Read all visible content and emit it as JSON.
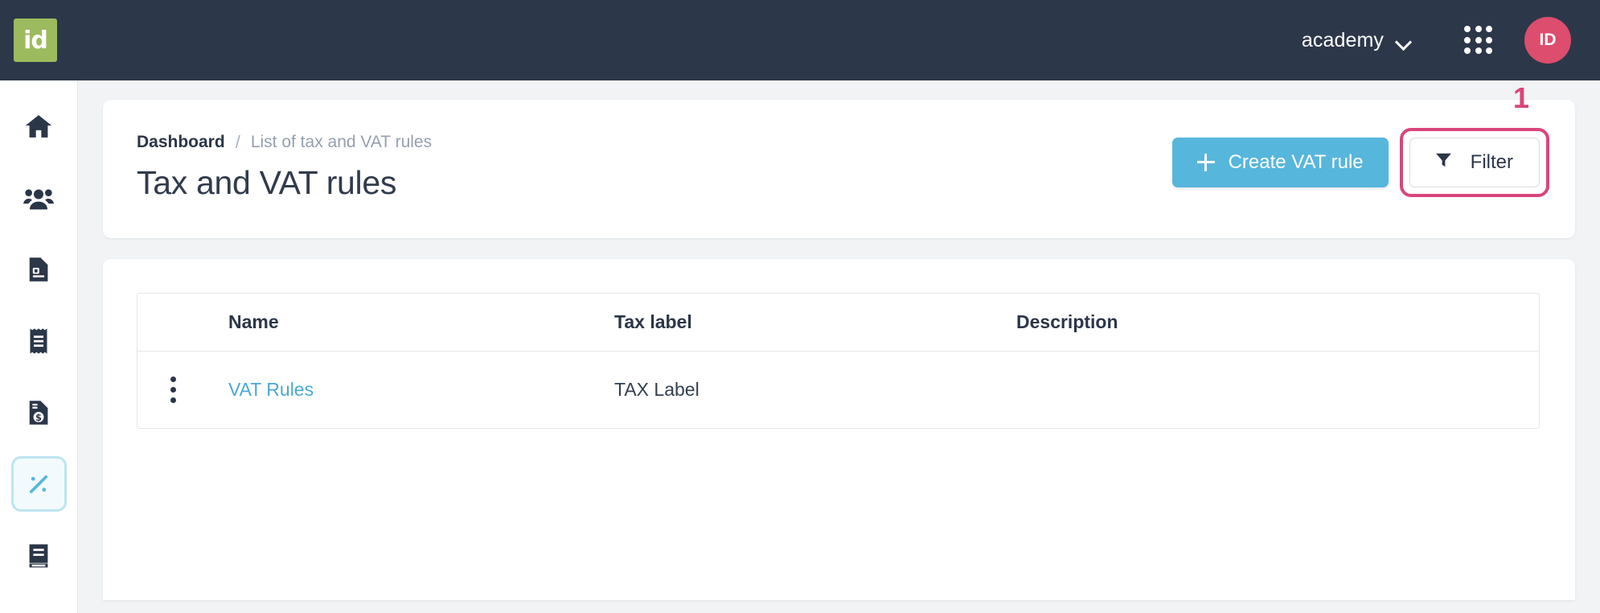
{
  "topbar": {
    "logo_text": "id",
    "logo_color": "#9cbb5e",
    "background": "#2c3749",
    "tenant_label": "academy",
    "tenant_chevron_icon": "chevron-down-icon",
    "apps_grid_icon": "apps-grid-icon",
    "avatar_initials": "ID",
    "avatar_color": "#dc4d6e"
  },
  "sidebar": {
    "items": [
      {
        "name": "home",
        "icon": "home-icon",
        "active": false
      },
      {
        "name": "customers",
        "icon": "users-group-icon",
        "active": false
      },
      {
        "name": "quotes",
        "icon": "document-list-icon",
        "active": false
      },
      {
        "name": "receipts",
        "icon": "receipt-icon",
        "active": false
      },
      {
        "name": "invoices",
        "icon": "invoice-dollar-icon",
        "active": false
      },
      {
        "name": "tax-vat-rules",
        "icon": "percent-icon",
        "active": true
      },
      {
        "name": "ledger",
        "icon": "book-icon",
        "active": false
      }
    ],
    "active_bg": "#f2fafd",
    "active_border": "#bde4f2",
    "active_icon_color": "#57b6dc"
  },
  "breadcrumb": {
    "root": "Dashboard",
    "separator": "/",
    "current": "List of tax and VAT rules"
  },
  "page": {
    "title": "Tax and VAT rules"
  },
  "actions": {
    "create_label": "Create VAT rule",
    "create_icon": "plus-icon",
    "create_color": "#57b6dc",
    "filter_label": "Filter",
    "filter_icon": "funnel-icon",
    "highlight_color": "#d9457b",
    "step_number": "1"
  },
  "table": {
    "columns": [
      "Name",
      "Tax label",
      "Description"
    ],
    "row_menu_icon": "kebab-menu-icon",
    "rows": [
      {
        "name": "VAT Rules",
        "tax_label": "TAX Label",
        "description": ""
      }
    ]
  }
}
